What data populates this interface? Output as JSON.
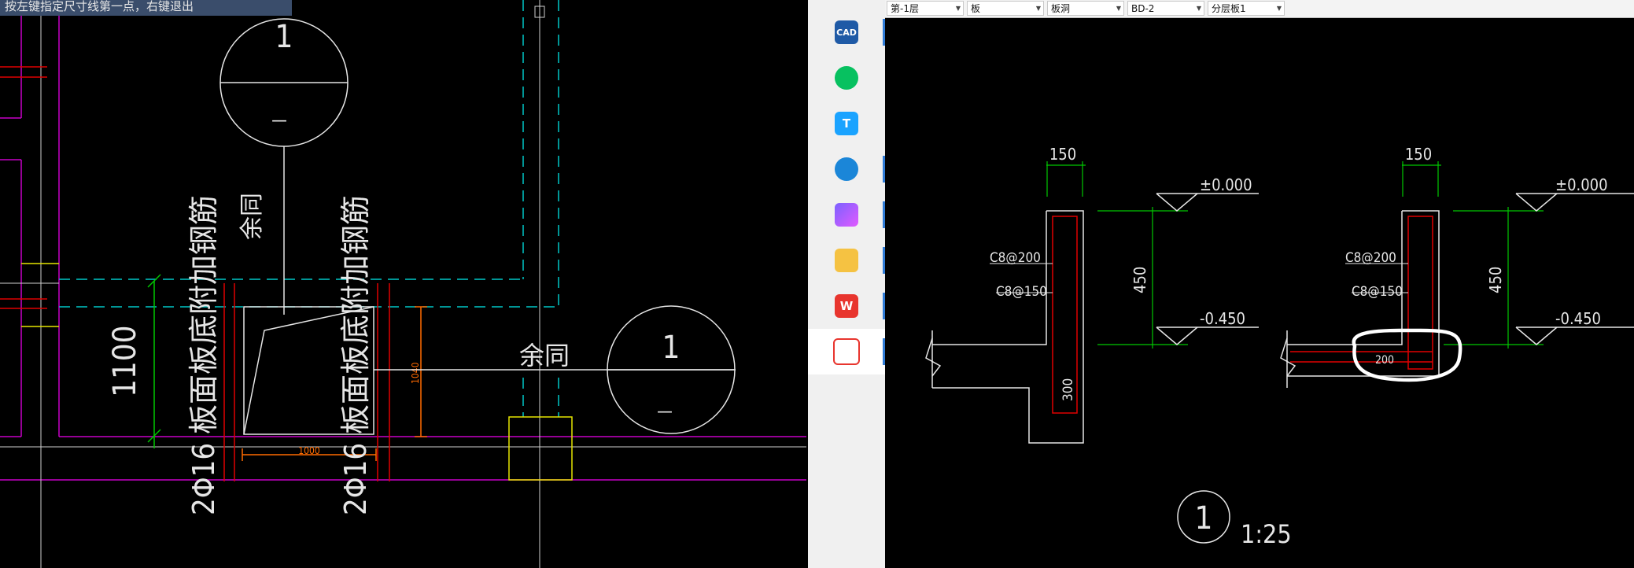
{
  "cad_tooltip": "按左键指定尺寸线第一点，右键退出",
  "left_drawing": {
    "section_marker_top": {
      "number": "1",
      "sheet": "—"
    },
    "section_marker_right": {
      "number": "1",
      "sheet": "—"
    },
    "note_same": "余同",
    "note_same_2": "余同",
    "rebar_note_left": "2Φ16 板面板底附加钢筋",
    "rebar_note_right": "2Φ16 板面板底附加钢筋",
    "dim_height": "1100",
    "dim_width": "1000",
    "dim_side": "1040"
  },
  "taskbar": {
    "items": [
      {
        "name": "cad-app-icon",
        "label": "CAD"
      },
      {
        "name": "wechat-icon",
        "label": ""
      },
      {
        "name": "tencent-meeting-icon",
        "label": "T"
      },
      {
        "name": "edge-browser-icon",
        "label": ""
      },
      {
        "name": "ai-app-icon",
        "label": ""
      },
      {
        "name": "file-explorer-icon",
        "label": ""
      },
      {
        "name": "wps-office-icon",
        "label": "W"
      },
      {
        "name": "screenshot-tool-icon",
        "label": ""
      }
    ]
  },
  "toolbar": {
    "floor": "第-1层",
    "component_type": "板",
    "component_subtype": "板洞",
    "component_name": "BD-2",
    "layer": "分层板1"
  },
  "right_drawing": {
    "detail_left": {
      "width": "150",
      "top_level": "±0.000",
      "bottom_level": "-0.450",
      "height": "450",
      "rebar_1": "C8@200",
      "rebar_2": "C8@150",
      "depth": "300"
    },
    "detail_right": {
      "width": "150",
      "top_level": "±0.000",
      "bottom_level": "-0.450",
      "height": "450",
      "rebar_1": "C8@200",
      "rebar_2": "C8@150",
      "callout": "200"
    },
    "detail_marker": {
      "number": "1",
      "scale": "1:25"
    }
  },
  "colors": {
    "green": "#00c800",
    "cyan": "#00c8c8",
    "magenta": "#c800c8",
    "red": "#e00000",
    "orange": "#ff6a00",
    "yellow": "#e6e600"
  }
}
